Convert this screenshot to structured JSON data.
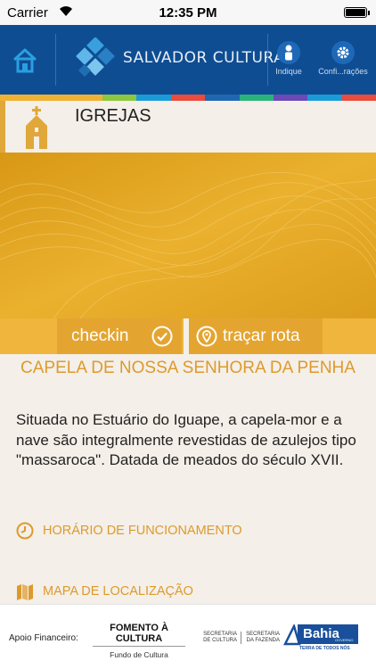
{
  "status_bar": {
    "carrier": "Carrier",
    "time": "12:35 PM"
  },
  "header": {
    "app_title": "SALVADOR CULTURAL",
    "indique_label": "Indique",
    "config_label": "Confi...rações",
    "icons": {
      "home": "home-icon",
      "indique": "person-icon",
      "config": "gear-icon"
    }
  },
  "color_strip": [
    "#f0b233",
    "#f0b233",
    "#f0b233",
    "#8dc63f",
    "#1a9bd7",
    "#e94b3c",
    "#1f67b1",
    "#2ab27b",
    "#6b49b7",
    "#1a9bd7",
    "#e94b3c"
  ],
  "category": {
    "label": "IGREJAS",
    "icon": "church-icon"
  },
  "actions": {
    "checkin_label": "checkin",
    "route_label": "traçar rota"
  },
  "place": {
    "title": "CAPELA DE NOSSA SENHORA DA PENHA",
    "description": "Situada no Estuário do Iguape, a capela-mor e a nave são integralmente revestidas de azulejos tipo \"massaroca\". Datada de meados do século XVII."
  },
  "links": {
    "horario": "HORÁRIO DE FUNCIONAMENTO",
    "mapa": "MAPA DE LOCALIZAÇÃO"
  },
  "footer": {
    "apoio": "Apoio Financeiro:",
    "fomento": "FOMENTO À CULTURA",
    "fundo": "Fundo de Cultura",
    "sec_cultura": "SECRETARIA DE CULTURA",
    "sec_fazenda": "SECRETARIA DA FAZENDA",
    "bahia": "Bahia",
    "governo": "GOVERNO",
    "tagline": "TERRA DE TODOS NÓS"
  },
  "colors": {
    "header_blue": "#0f4d93",
    "accent_gold": "#e3a21a",
    "title_gold": "#dd9a2c"
  }
}
